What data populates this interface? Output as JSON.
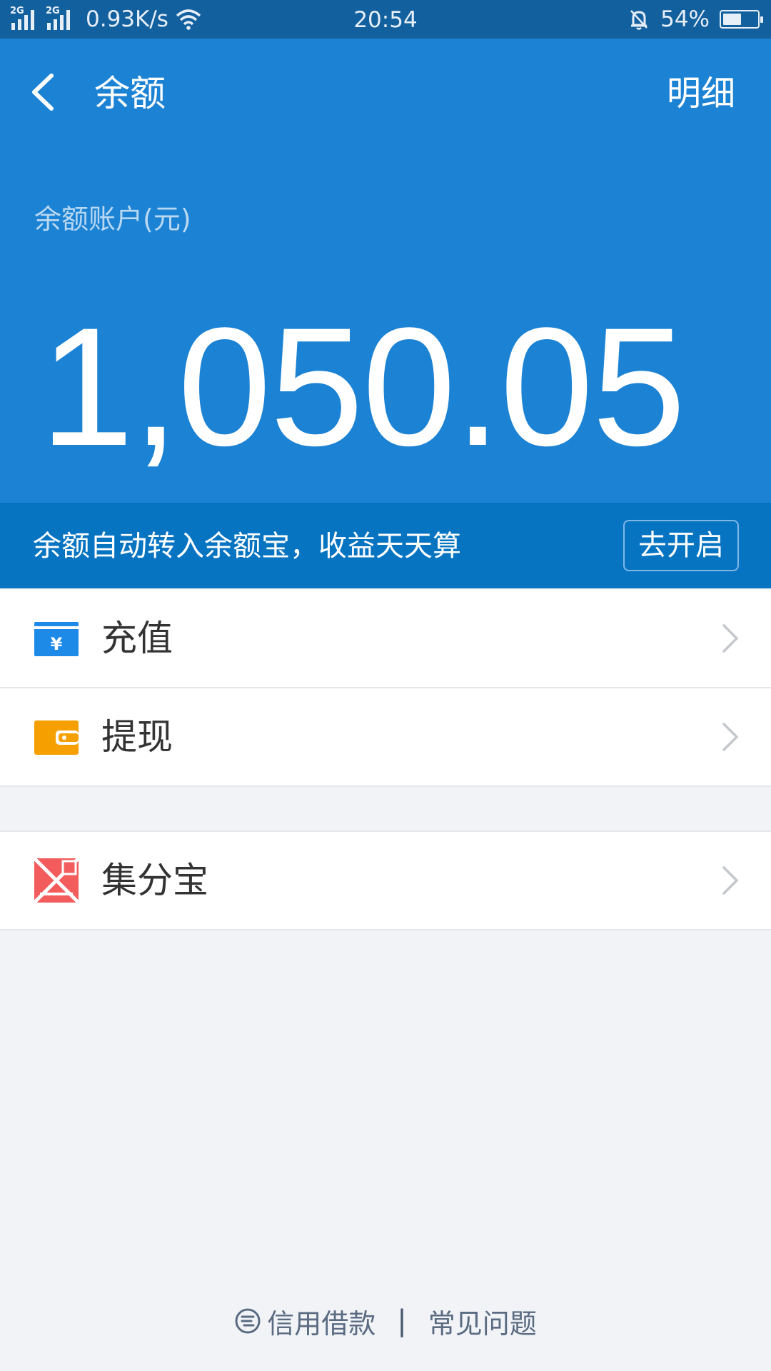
{
  "status_bar": {
    "sim1": "2G",
    "sim2": "2G",
    "speed": "0.93K/s",
    "time": "20:54",
    "battery": "54%",
    "battery_level": 0.54
  },
  "header": {
    "title": "余额",
    "detail_label": "明细",
    "account_label": "余额账户(元)",
    "balance": "1,050.05"
  },
  "banner": {
    "text": "余额自动转入余额宝，收益天天算",
    "button_label": "去开启"
  },
  "menu": {
    "recharge": "充值",
    "withdraw": "提现",
    "points": "集分宝"
  },
  "footer": {
    "credit_loan": "信用借款",
    "separator": "|",
    "faq": "常见问题"
  },
  "colors": {
    "header_bg": "#1c82d4",
    "banner_bg": "#0774c2",
    "status_bg": "#13609f",
    "recharge_icon": "#1c8ae6",
    "withdraw_icon": "#f5a000",
    "points_icon": "#f25c5c"
  },
  "icons": {
    "back": "back-arrow-icon",
    "recharge": "recharge-card-icon",
    "withdraw": "wallet-icon",
    "points": "points-icon",
    "chevron": "chevron-right-icon",
    "credit": "credit-loan-icon"
  }
}
